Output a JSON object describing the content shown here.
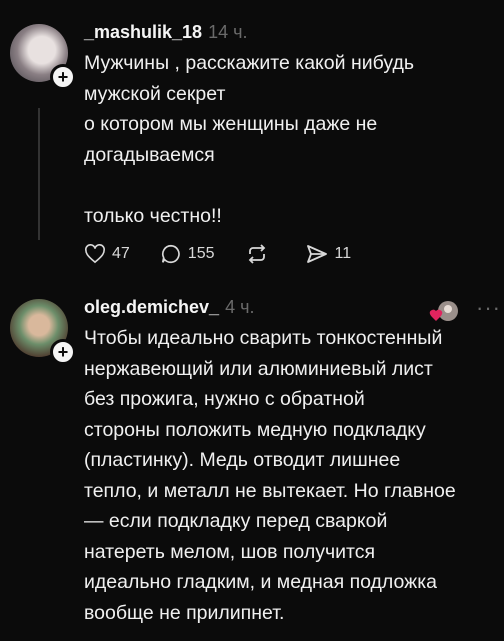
{
  "posts": [
    {
      "username": "_mashulik_18",
      "time": "14 ч.",
      "text": "Мужчины , расскажите какой нибудь\nмужской секрет\nо котором мы женщины  даже не\nдогадываемся\n\nтолько честно!!",
      "likes": "47",
      "comments": "155",
      "shares": "11"
    },
    {
      "username": "oleg.demichev_",
      "time": "4 ч.",
      "more": "···",
      "lines": [
        "Чтобы идеально сварить тонкостенный",
        "нержавеющий или алюминиевый лист",
        "без прожига, нужно с обратной",
        "стороны положить медную подкладку",
        "(пластинку). Медь отводит лишнее",
        "тепло, и металл не вытекает. Но главное",
        "— если подкладку перед сваркой",
        "натереть мелом, шов получится",
        "идеально гладким, и медная подложка",
        "вообще не прилипнет."
      ]
    }
  ]
}
